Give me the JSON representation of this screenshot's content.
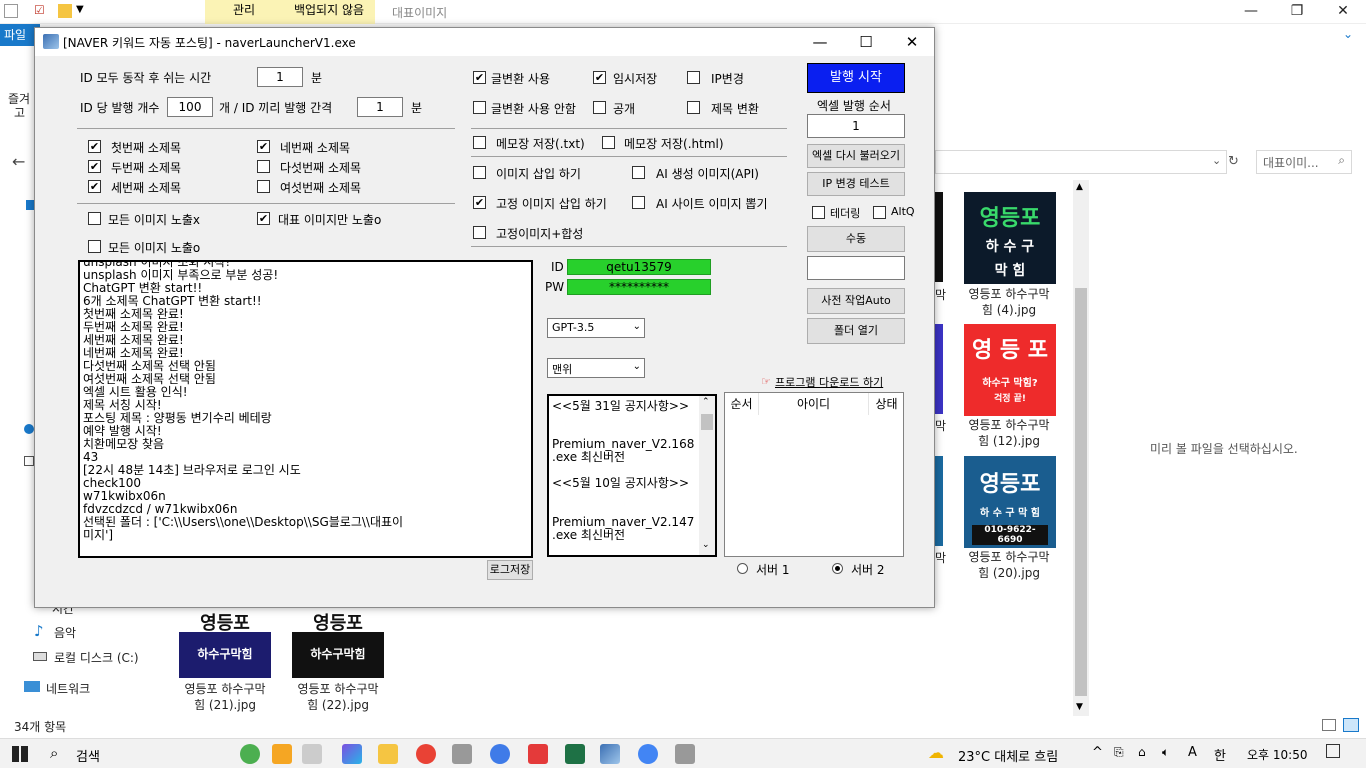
{
  "explorer": {
    "ribbon_tabs": [
      "관리",
      "백업되지 않음",
      "대표이미지"
    ],
    "file_tab": "파일",
    "left_labels": [
      "즐겨",
      "고"
    ],
    "search_placeholder": "대표이미...",
    "preview_text": "미리 볼 파일을 선택하십시오.",
    "status": "34개 항목",
    "sidebar": [
      "시간",
      "음악",
      "로컬 디스크 (C:)",
      "네트워크"
    ],
    "thumbs": [
      {
        "l1": "영등포",
        "l2": "하 수 구",
        "l3": "막 힘",
        "cap1": "영등포 하수구막",
        "cap2": "힘 (4).jpg"
      },
      {
        "l1": "영 등 포",
        "l2": "하수구 막힘?",
        "l3": "걱정 끝!",
        "cap1": "영등포 하수구막",
        "cap2": "힘 (12).jpg"
      },
      {
        "l1": "영등포",
        "l2": "하 수 구 막 힘",
        "l3": "010-9622-6690",
        "cap1": "영등포 하수구막",
        "cap2": "힘 (20).jpg"
      },
      {
        "l1": "영등포",
        "l2": "하수구막힘",
        "l3": "",
        "cap1": "영등포 하수구막",
        "cap2": "힘 (21).jpg"
      },
      {
        "l1": "영등포",
        "l2": "하수구막힘",
        "l3": "",
        "cap1": "영등포 하수구막",
        "cap2": "힘 (22).jpg"
      }
    ],
    "partial_caps": [
      "막",
      "막",
      "막"
    ]
  },
  "app": {
    "title": "[NAVER 키워드 자동 포스팅] - naverLauncherV1.exe",
    "rest_label": "ID 모두 동작 후 쉬는 시간",
    "rest_value": "1",
    "rest_unit": "분",
    "count_label": "ID 당 발행 개수",
    "count_value": "100",
    "count_mid": "개 / ID 끼리 발행 간격",
    "interval_value": "1",
    "interval_unit": "분",
    "subtitles": [
      {
        "label": "첫번째 소제목",
        "checked": "✔"
      },
      {
        "label": "두번째 소제목",
        "checked": "✔"
      },
      {
        "label": "세번째 소제목",
        "checked": "✔"
      },
      {
        "label": "네번째 소제목",
        "checked": "✔"
      },
      {
        "label": "다섯번째 소제목",
        "checked": ""
      },
      {
        "label": "여섯번째 소제목",
        "checked": ""
      }
    ],
    "img_opts": [
      {
        "label": "모든 이미지 노출x",
        "checked": ""
      },
      {
        "label": "대표 이미지만 노출o",
        "checked": "✔"
      },
      {
        "label": "모든 이미지 노출o",
        "checked": ""
      }
    ],
    "right_opts": [
      {
        "label": "글변환 사용",
        "checked": "✔"
      },
      {
        "label": "임시저장",
        "checked": "✔"
      },
      {
        "label": "IP변경",
        "checked": ""
      },
      {
        "label": "글변환 사용 안함",
        "checked": ""
      },
      {
        "label": "공개",
        "checked": ""
      },
      {
        "label": "제목 변환",
        "checked": ""
      },
      {
        "label": "메모장 저장(.txt)",
        "checked": ""
      },
      {
        "label": "메모장 저장(.html)",
        "checked": ""
      },
      {
        "label": "이미지 삽입 하기",
        "checked": ""
      },
      {
        "label": "AI 생성 이미지(API)",
        "checked": ""
      },
      {
        "label": "고정 이미지 삽입 하기",
        "checked": "✔"
      },
      {
        "label": "AI 사이트 이미지 뽑기",
        "checked": ""
      },
      {
        "label": "고정이미지+합성",
        "checked": ""
      }
    ],
    "log_lines": [
      "unsplash 이미지 조회 시작!",
      "unsplash 이미지 부족으로 부분 성공!",
      "ChatGPT 변환 start!!",
      "6개 소제목 ChatGPT 변환 start!!",
      "첫번째 소제목 완료!",
      "두번째 소제목 완료!",
      "세번째 소제목 완료!",
      "네번째 소제목 완료!",
      "다섯번째 소제목 선택 안됨",
      "여섯번째 소제목 선택 안됨",
      "엑셀 시트 활용 인식!",
      "제목 서칭 시작!",
      "포스팅 제목 : 양평동 변기수리 베테랑",
      "예약 발행 시작!",
      "치환메모장 찾음",
      "43",
      "[22시 48분 14초] 브라우저로 로그인 시도",
      "check100",
      "w71kwibx06n",
      "fdvzcdzcd / w71kwibx06n",
      "선택된 폴더 : ['C:\\\\Users\\\\one\\\\Desktop\\\\SG블로그\\\\대표이",
      "미지']"
    ],
    "log_save": "로그저장",
    "id_label": "ID",
    "id_value": "qetu13579",
    "pw_label": "PW",
    "pw_value": "**********",
    "model": "GPT-3.5",
    "position": "맨위",
    "notice_lines": [
      "<<5월 31일 공지사항>>",
      "Premium_naver_V2.168",
      ".exe 최신버전",
      "<<5월 10일 공지사항>>",
      "Premium_naver_V2.147",
      ".exe 최신버전"
    ],
    "download_link": "프로그램 다운로드 하기",
    "table_headers": [
      "순서",
      "아이디",
      "상태"
    ],
    "server1": "서버 1",
    "server2": "서버 2",
    "publish_btn": "발행 시작",
    "excel_order_label": "엑셀 발행 순서",
    "excel_order_value": "1",
    "reload_btn": "엑셀 다시 불러오기",
    "ip_test_btn": "IP 변경 테스트",
    "tethering": "테더링",
    "altq": "AltQ",
    "manual_btn": "수동",
    "dict_btn": "사전 작업Auto",
    "folder_btn": "폴더 열기"
  },
  "taskbar": {
    "search": "검색",
    "weather": "23°C  대체로 흐림",
    "ime": "A",
    "lang": "한",
    "time": "오후 10:50"
  },
  "colors": {
    "publish_blue": "#0a1ff0",
    "green": "#28d02c",
    "file_tab": "#1979ca"
  }
}
